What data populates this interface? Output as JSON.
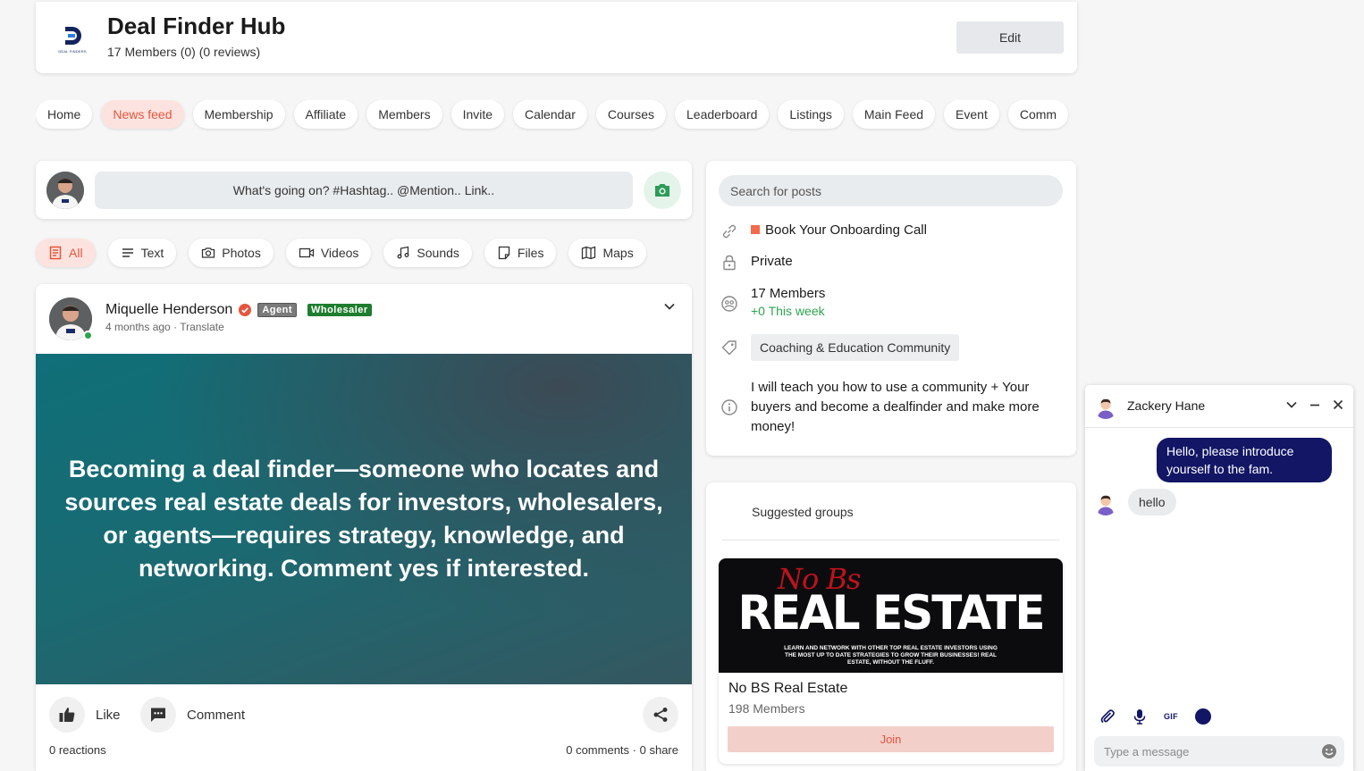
{
  "header": {
    "title": "Deal Finder Hub",
    "meta": "17 Members (0) (0 reviews)",
    "edit_label": "Edit",
    "logo_icon": "deal-finder-logo",
    "logo_caption": "DEAL FINDERS"
  },
  "tabs": [
    {
      "label": "Home",
      "active": false
    },
    {
      "label": "News feed",
      "active": true
    },
    {
      "label": "Membership",
      "active": false
    },
    {
      "label": "Affiliate",
      "active": false
    },
    {
      "label": "Members",
      "active": false
    },
    {
      "label": "Invite",
      "active": false
    },
    {
      "label": "Calendar",
      "active": false
    },
    {
      "label": "Courses",
      "active": false
    },
    {
      "label": "Leaderboard",
      "active": false
    },
    {
      "label": "Listings",
      "active": false
    },
    {
      "label": "Main Feed",
      "active": false
    },
    {
      "label": "Event",
      "active": false
    },
    {
      "label": "Comm",
      "active": false
    }
  ],
  "composer": {
    "placeholder": "What's going on? #Hashtag.. @Mention.. Link..",
    "camera_icon": "camera-icon"
  },
  "filters": [
    {
      "label": "All",
      "icon": "document-icon",
      "active": true
    },
    {
      "label": "Text",
      "icon": "text-lines-icon",
      "active": false
    },
    {
      "label": "Photos",
      "icon": "camera-icon",
      "active": false
    },
    {
      "label": "Videos",
      "icon": "video-icon",
      "active": false
    },
    {
      "label": "Sounds",
      "icon": "music-note-icon",
      "active": false
    },
    {
      "label": "Files",
      "icon": "file-icon",
      "active": false
    },
    {
      "label": "Maps",
      "icon": "map-icon",
      "active": false
    }
  ],
  "post": {
    "author": "Miquelle Henderson",
    "badges": {
      "agent": "Agent",
      "wholesaler": "Wholesaler"
    },
    "time": "4 months ago",
    "translate": "Translate",
    "banner_text": "Becoming a deal finder—someone who locates and sources real estate deals for investors, wholesalers, or agents—requires strategy, knowledge, and networking. Comment yes if interested.",
    "like_label": "Like",
    "comment_label": "Comment",
    "reactions": "0 reactions",
    "comments": "0 comments",
    "shares": "0 share"
  },
  "about": {
    "search_placeholder": "Search for posts",
    "onboarding": "Book Your Onboarding Call",
    "privacy": "Private",
    "members": "17 Members",
    "members_week": "+0 This week",
    "category": "Coaching & Education Community",
    "description": "I will teach you how to use a community + Your buyers and become a dealfinder and make more money!"
  },
  "suggested": {
    "title": "Suggested groups",
    "group": {
      "image_script": "No Bs",
      "image_title": "REAL ESTATE",
      "image_tagline": "LEARN AND NETWORK WITH OTHER TOP REAL ESTATE INVESTORS USING THE MOST UP TO DATE STRATEGIES TO GROW THEIR BUSINESSES! REAL ESTATE, WITHOUT THE FLUFF.",
      "name": "No BS Real Estate",
      "members": "198 Members",
      "join_label": "Join"
    }
  },
  "chat": {
    "contact": "Zackery Hane",
    "messages": [
      {
        "from": "me",
        "text": "Hello, please introduce yourself to the fam."
      },
      {
        "from": "them",
        "text": "hello"
      }
    ],
    "gif_label": "GIF",
    "input_placeholder": "Type a message"
  },
  "colors": {
    "accent": "#e5553c",
    "accent_bg": "#fde3df",
    "chat_bubble": "#121665",
    "green": "#2ea44f"
  }
}
